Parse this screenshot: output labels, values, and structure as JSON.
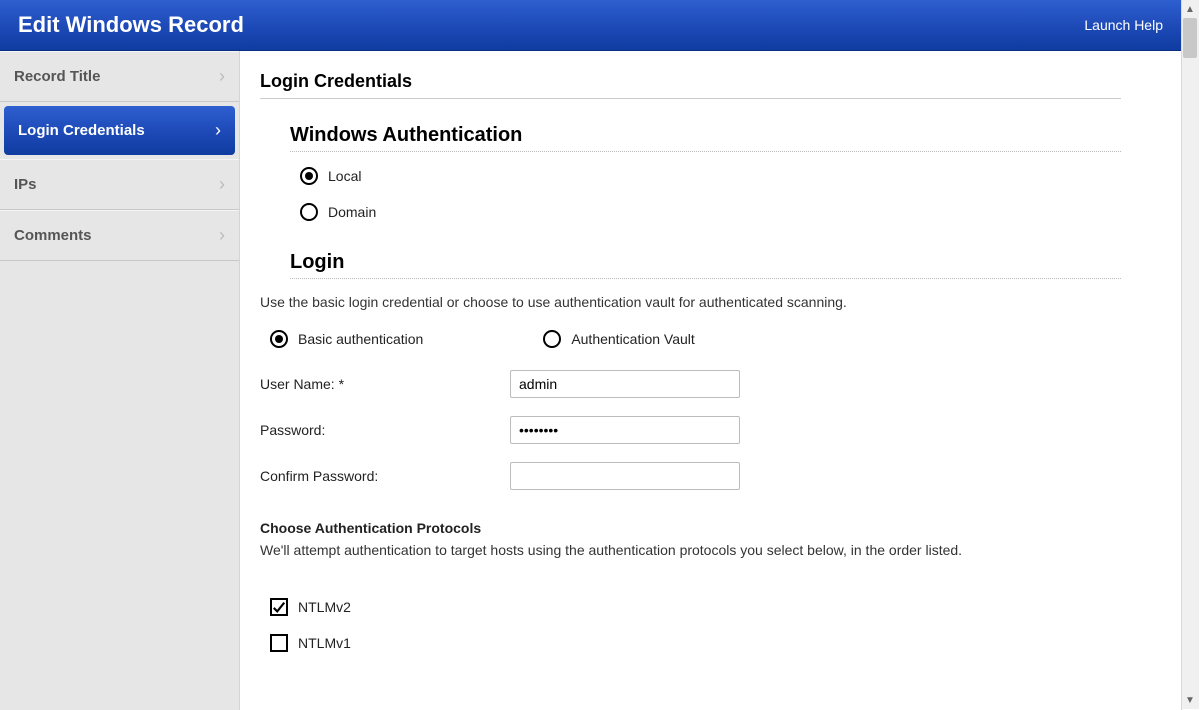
{
  "header": {
    "title": "Edit Windows Record",
    "help_label": "Launch Help"
  },
  "sidebar": {
    "items": [
      {
        "label": "Record Title",
        "active": false
      },
      {
        "label": "Login Credentials",
        "active": true
      },
      {
        "label": "IPs",
        "active": false
      },
      {
        "label": "Comments",
        "active": false
      }
    ]
  },
  "main": {
    "page_title": "Login Credentials",
    "auth_section": {
      "heading": "Windows Authentication",
      "radio_local": "Local",
      "radio_domain": "Domain",
      "selected": "local"
    },
    "login_section": {
      "heading": "Login",
      "description": "Use the basic login credential or choose to use authentication vault for authenticated scanning.",
      "radio_basic": "Basic authentication",
      "radio_vault": "Authentication Vault",
      "selected": "basic",
      "username_label": "User Name: *",
      "username_value": "admin",
      "password_label": "Password:",
      "password_value": "••••••••",
      "confirm_label": "Confirm Password:",
      "confirm_value": ""
    },
    "protocols_section": {
      "heading": "Choose Authentication Protocols",
      "description": "We'll attempt authentication to target hosts using the authentication protocols you select below, in the order listed.",
      "items": [
        {
          "label": "NTLMv2",
          "checked": true
        },
        {
          "label": "NTLMv1",
          "checked": false
        }
      ]
    }
  }
}
